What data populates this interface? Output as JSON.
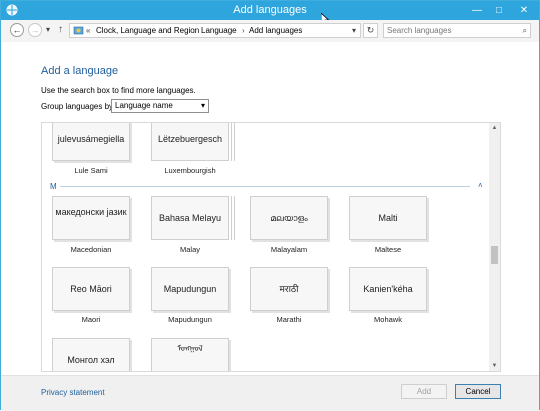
{
  "window": {
    "title": "Add languages",
    "minimize": "—",
    "maximize": "□",
    "close": "✕"
  },
  "nav": {
    "back": "←",
    "forward": "→",
    "recent": "▾",
    "up": "↑",
    "overflow": "«",
    "breadcrumbs": [
      "Clock, Language and Region",
      "Language",
      "Add languages"
    ],
    "separator": "›",
    "dropdown": "▾",
    "refresh": "↻",
    "search_placeholder": "Search languages",
    "search_icon": "⌕"
  },
  "content": {
    "heading": "Add a language",
    "instruction": "Use the search box to find more languages.",
    "group_label": "Group languages by:",
    "group_value": "Language name",
    "group_dd": "▾",
    "section_letter": "M",
    "collapse_glyph": "˄",
    "tiles_top": [
      {
        "tile": "julevusámegiella",
        "label": "Lule Sami"
      },
      {
        "tile": "Lëtzebuergesch",
        "label": "Luxembourgish"
      }
    ],
    "tiles_row1": [
      {
        "tile": "македонски јазик",
        "label": "Macedonian"
      },
      {
        "tile": "Bahasa Melayu",
        "label": "Malay"
      },
      {
        "tile": "മലയാളം",
        "label": "Malayalam"
      },
      {
        "tile": "Malti",
        "label": "Maltese"
      }
    ],
    "tiles_row2": [
      {
        "tile": "Reo Māori",
        "label": "Maori"
      },
      {
        "tile": "Mapudungun",
        "label": "Mapudungun"
      },
      {
        "tile": "मराठी",
        "label": "Marathi"
      },
      {
        "tile": "Kanien'kéha",
        "label": "Mohawk"
      }
    ],
    "tiles_row3": [
      {
        "tile": "Монгол хэл",
        "label": ""
      },
      {
        "tile": "ᠮᠣᠩᠭᠣᠯ",
        "label": ""
      }
    ],
    "scroll_up": "▲",
    "scroll_down": "▼"
  },
  "footer": {
    "privacy": "Privacy statement",
    "add": "Add",
    "cancel": "Cancel"
  }
}
